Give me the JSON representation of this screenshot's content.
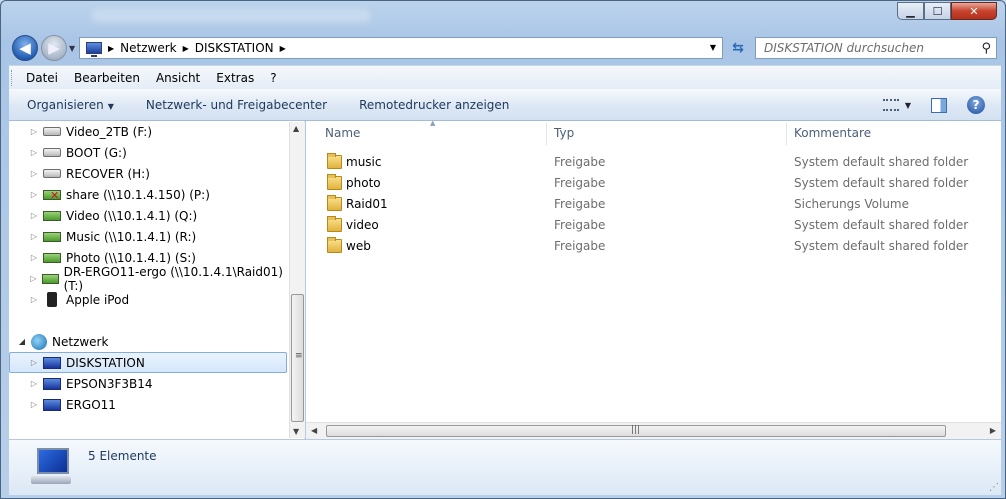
{
  "window": {
    "minimize_icon": "minimize-icon",
    "maximize_icon": "maximize-icon",
    "close_icon": "close-icon"
  },
  "address": {
    "crumbs": [
      "Netzwerk",
      "DISKSTATION"
    ],
    "search_placeholder": "DISKSTATION durchsuchen"
  },
  "menu": [
    "Datei",
    "Bearbeiten",
    "Ansicht",
    "Extras",
    "?"
  ],
  "commands": {
    "organize": "Organisieren",
    "network_center": "Netzwerk- und Freigabecenter",
    "remote_printer": "Remotedrucker anzeigen"
  },
  "tree": [
    {
      "label": "Video_2TB (F:)",
      "icon": "drive-icon"
    },
    {
      "label": "BOOT (G:)",
      "icon": "drive-icon"
    },
    {
      "label": "RECOVER (H:)",
      "icon": "drive-icon"
    },
    {
      "label": "share (\\\\10.1.4.150) (P:)",
      "icon": "disconnected-network-drive-icon"
    },
    {
      "label": "Video (\\\\10.1.4.1) (Q:)",
      "icon": "network-drive-icon"
    },
    {
      "label": "Music (\\\\10.1.4.1) (R:)",
      "icon": "network-drive-icon"
    },
    {
      "label": "Photo (\\\\10.1.4.1) (S:)",
      "icon": "network-drive-icon"
    },
    {
      "label": "DR-ERGO11-ergo (\\\\10.1.4.1\\Raid01) (T:)",
      "icon": "network-drive-icon"
    },
    {
      "label": "Apple iPod",
      "icon": "ipod-icon"
    }
  ],
  "network_tree": {
    "root": "Netzwerk",
    "items": [
      "DISKSTATION",
      "EPSON3F3B14",
      "ERGO11"
    ],
    "selected": "DISKSTATION"
  },
  "columns": {
    "name": "Name",
    "type": "Typ",
    "comment": "Kommentare"
  },
  "rows": [
    {
      "name": "music",
      "type": "Freigabe",
      "comment": "System default shared folder"
    },
    {
      "name": "photo",
      "type": "Freigabe",
      "comment": "System default shared folder"
    },
    {
      "name": "Raid01",
      "type": "Freigabe",
      "comment": "Sicherungs Volume"
    },
    {
      "name": "video",
      "type": "Freigabe",
      "comment": "System default shared folder"
    },
    {
      "name": "web",
      "type": "Freigabe",
      "comment": "System default shared folder"
    }
  ],
  "status": {
    "count_text": "5 Elemente"
  }
}
